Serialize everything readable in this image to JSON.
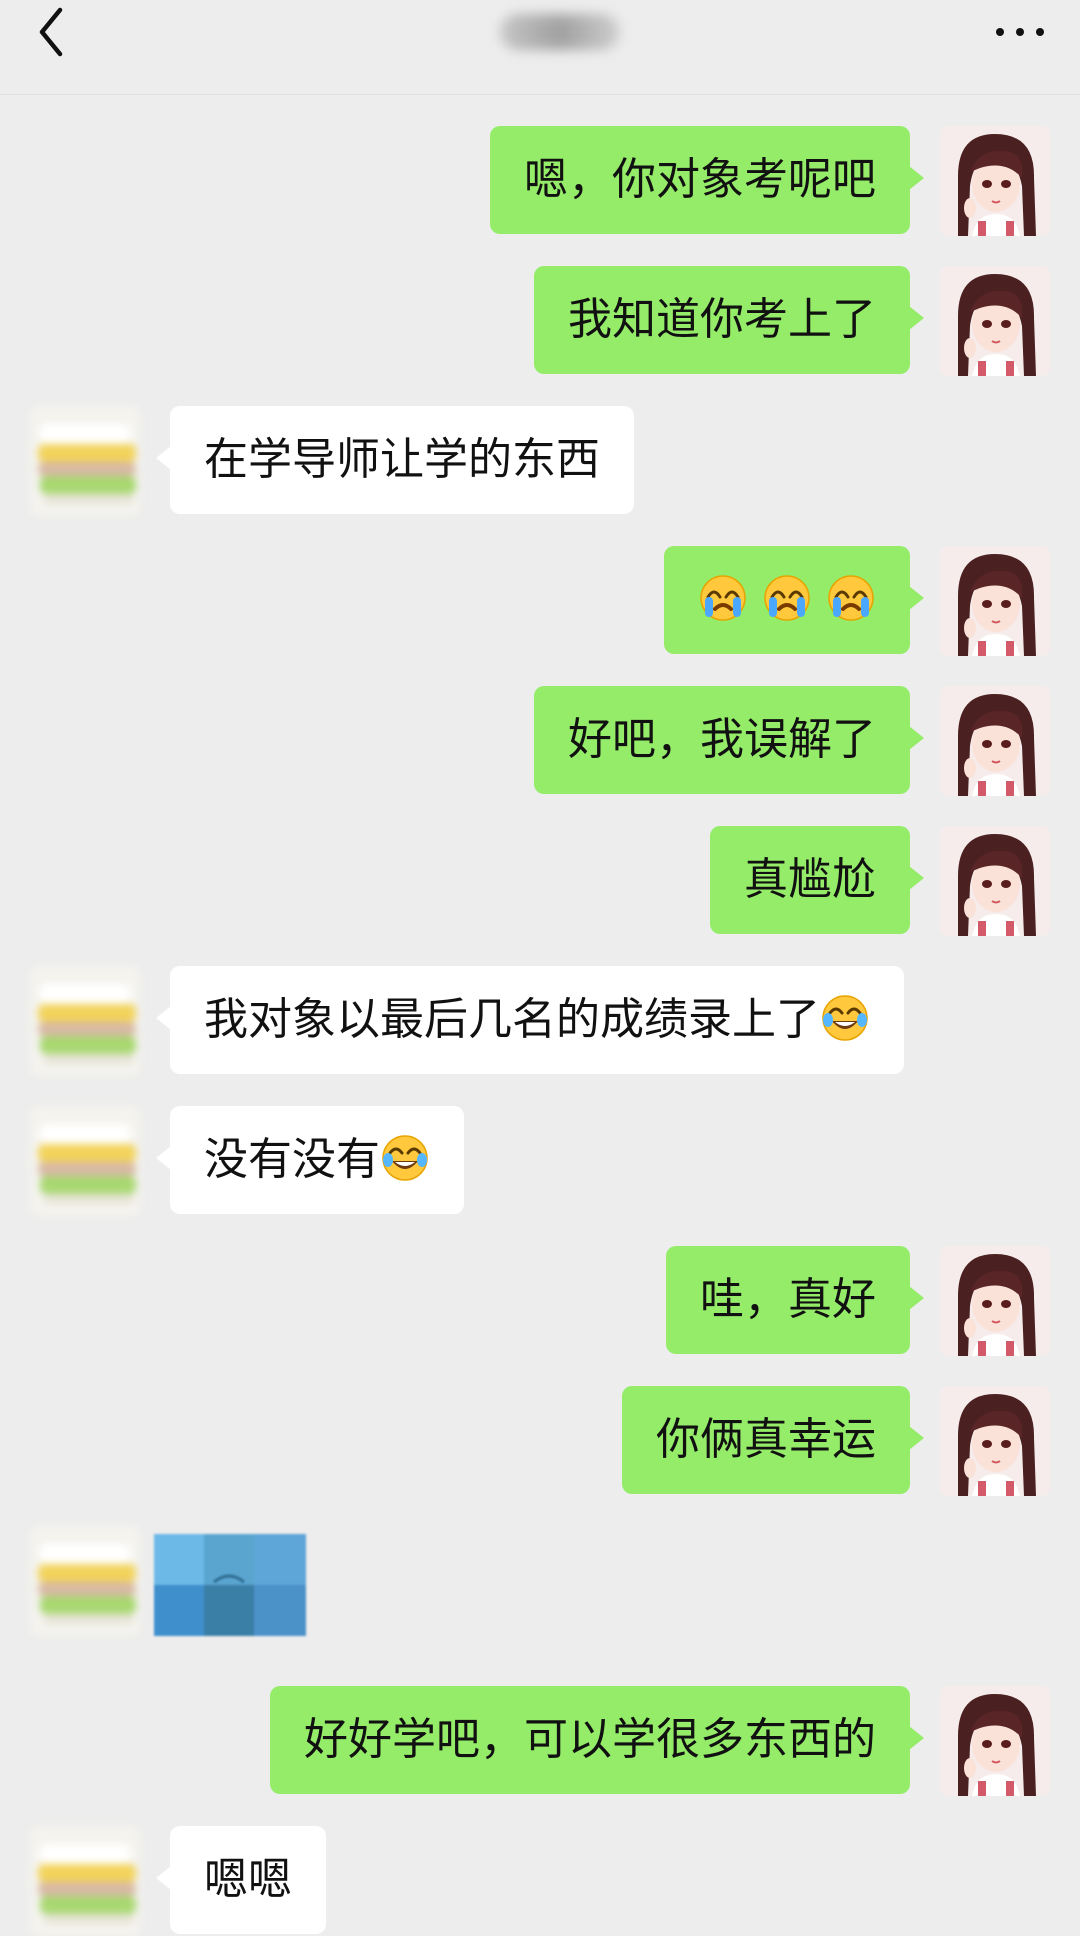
{
  "header": {
    "back_icon": "chevron-left-icon",
    "more_icon": "more-horizontal-icon"
  },
  "colors": {
    "background": "#ededed",
    "outgoing_bubble": "#95ec69",
    "incoming_bubble": "#ffffff"
  },
  "messages": [
    {
      "sender": "me",
      "text": "嗯，你对象考呢吧"
    },
    {
      "sender": "me",
      "text": "我知道你考上了"
    },
    {
      "sender": "them",
      "text": "在学导师让学的东西"
    },
    {
      "sender": "me",
      "text": "",
      "emojis": [
        "crying-face",
        "crying-face",
        "crying-face"
      ]
    },
    {
      "sender": "me",
      "text": "好吧，我误解了"
    },
    {
      "sender": "me",
      "text": "真尴尬"
    },
    {
      "sender": "them",
      "text": "我对象以最后几名的成绩录上了",
      "emoji": "tears-of-joy"
    },
    {
      "sender": "them",
      "text": "没有没有",
      "emoji": "tears-of-joy"
    },
    {
      "sender": "me",
      "text": "哇，真好"
    },
    {
      "sender": "me",
      "text": "你俩真幸运"
    },
    {
      "sender": "them",
      "type": "image",
      "text": ""
    },
    {
      "sender": "me",
      "text": "好好学吧，可以学很多东西的"
    },
    {
      "sender": "them",
      "text": "嗯嗯"
    }
  ]
}
